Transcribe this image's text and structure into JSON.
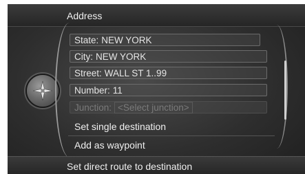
{
  "header": {
    "title": "Address"
  },
  "knob_icon": "compass-rose-icon",
  "fields": [
    {
      "label": "State:",
      "value": "NEW YORK"
    },
    {
      "label": "City:",
      "value": "NEW YORK"
    },
    {
      "label": "Street:",
      "value": "WALL ST 1..99"
    },
    {
      "label": "Number:",
      "value": "11"
    },
    {
      "label": "Junction:",
      "value": "<Select junction>"
    }
  ],
  "actions": {
    "set_single_destination": "Set single destination",
    "add_as_waypoint": "Add as waypoint"
  },
  "footer": {
    "label": "Set direct route to destination"
  },
  "colors": {
    "background": "#2e2e2e",
    "text": "#f0f0f0",
    "disabled_text": "#7a7a7a"
  }
}
